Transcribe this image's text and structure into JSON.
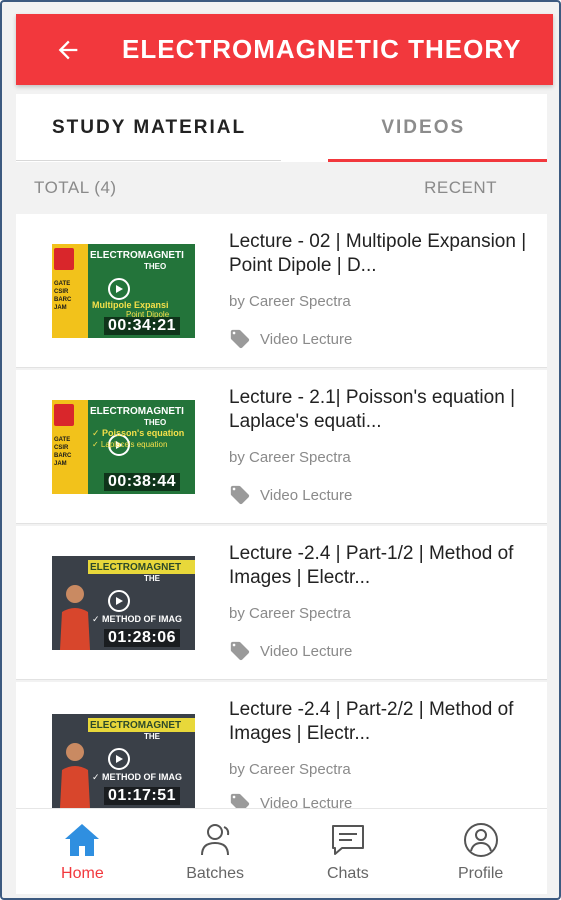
{
  "header": {
    "title": "ELECTROMAGNETIC THEORY"
  },
  "tabs": [
    {
      "label": "STUDY MATERIAL"
    },
    {
      "label": "VIDEOS"
    }
  ],
  "summary": {
    "total": "TOTAL (4)",
    "sort": "RECENT"
  },
  "videos": [
    {
      "title": "Lecture - 02 | Multipole Expansion | Point Dipole | D...",
      "author": "by Career Spectra",
      "tag": "Video Lecture",
      "thumb": {
        "heading": "ELECTROMAGNETI",
        "heading2": "THEO",
        "line1": "Multipole Expansi",
        "line2": "Point Dipole",
        "duration": "00:34:21"
      }
    },
    {
      "title": "Lecture - 2.1| Poisson's equation | Laplace's equati...",
      "author": "by Career Spectra",
      "tag": "Video Lecture",
      "thumb": {
        "heading": "ELECTROMAGNETI",
        "heading2": "THEO",
        "line1": "✓ Poisson's equation",
        "line2": "✓ Laplace's equation",
        "duration": "00:38:44"
      }
    },
    {
      "title": "Lecture -2.4 | Part-1/2 | Method of Images | Electr...",
      "author": "by Career Spectra",
      "tag": "Video Lecture",
      "thumb": {
        "heading": "ELECTROMAGNET",
        "heading2": "THE",
        "line1": "✓ METHOD OF IMAG",
        "line2": "",
        "duration": "01:28:06"
      }
    },
    {
      "title": "Lecture -2.4 | Part-2/2 | Method of Images | Electr...",
      "author": "by Career Spectra",
      "tag": "Video Lecture",
      "thumb": {
        "heading": "ELECTROMAGNET",
        "heading2": "THE",
        "line1": "✓ METHOD OF IMAG",
        "line2": "",
        "duration": "01:17:51"
      }
    }
  ],
  "bottom_nav": [
    {
      "label": "Home",
      "icon": "home-icon",
      "active": true
    },
    {
      "label": "Batches",
      "icon": "users-icon",
      "active": false
    },
    {
      "label": "Chats",
      "icon": "chat-icon",
      "active": false
    },
    {
      "label": "Profile",
      "icon": "profile-icon",
      "active": false
    }
  ],
  "colors": {
    "accent": "#f2383d",
    "muted_text": "#8a8a8a",
    "background": "#f2f2f2"
  }
}
